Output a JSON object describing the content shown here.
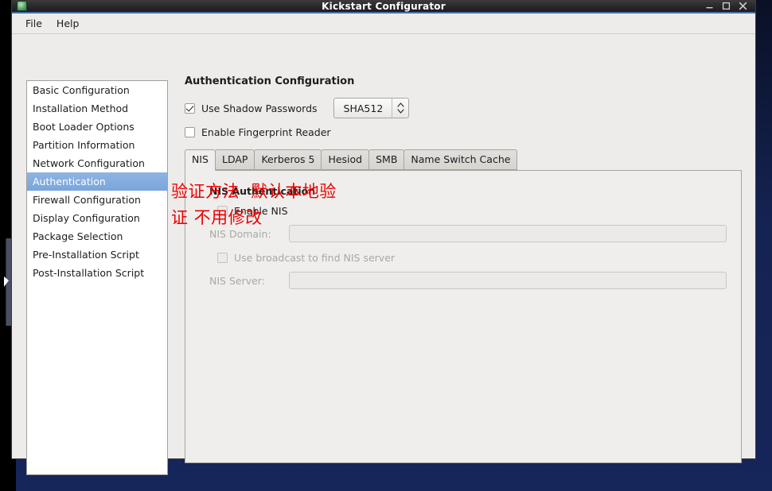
{
  "window": {
    "title": "Kickstart Configurator",
    "icon": "app-icon",
    "buttons": {
      "minimize": "minimize-icon",
      "maximize": "maximize-icon",
      "close": "close-icon"
    }
  },
  "menubar": {
    "items": [
      {
        "label": "File"
      },
      {
        "label": "Help"
      }
    ]
  },
  "sidebar": {
    "items": [
      {
        "label": "Basic Configuration",
        "selected": false
      },
      {
        "label": "Installation Method",
        "selected": false
      },
      {
        "label": "Boot Loader Options",
        "selected": false
      },
      {
        "label": "Partition Information",
        "selected": false
      },
      {
        "label": "Network Configuration",
        "selected": false
      },
      {
        "label": "Authentication",
        "selected": true
      },
      {
        "label": "Firewall Configuration",
        "selected": false
      },
      {
        "label": "Display Configuration",
        "selected": false
      },
      {
        "label": "Package Selection",
        "selected": false
      },
      {
        "label": "Pre-Installation Script",
        "selected": false
      },
      {
        "label": "Post-Installation Script",
        "selected": false
      }
    ]
  },
  "main": {
    "title": "Authentication Configuration",
    "shadow_passwords": {
      "label": "Use Shadow Passwords",
      "checked": true
    },
    "hash_algorithm": {
      "value": "SHA512",
      "stepper": "spin-up-down-icon"
    },
    "fingerprint_reader": {
      "label": "Enable Fingerprint Reader",
      "checked": false
    },
    "tabs": [
      {
        "label": "NIS",
        "active": true
      },
      {
        "label": "LDAP",
        "active": false
      },
      {
        "label": "Kerberos 5",
        "active": false
      },
      {
        "label": "Hesiod",
        "active": false
      },
      {
        "label": "SMB",
        "active": false
      },
      {
        "label": "Name Switch Cache",
        "active": false
      }
    ],
    "nis_panel": {
      "group_title": "NIS Authentication",
      "enable_nis": {
        "label": "Enable NIS",
        "checked": false
      },
      "nis_domain": {
        "label": "NIS Domain:",
        "value": "",
        "placeholder": ""
      },
      "use_broadcast": {
        "label": "Use broadcast to find NIS server",
        "checked": false
      },
      "nis_server": {
        "label": "NIS Server:",
        "value": "",
        "placeholder": ""
      }
    }
  },
  "annotation": {
    "line1": "验证方法  默认本地验",
    "line2": "证 不用修改",
    "color": "#ee0000"
  },
  "colors": {
    "accent_selection": "#7aa5dd",
    "titlebar_underline": "#4a6ea8",
    "window_bg": "#edecea",
    "desktop_bg": "#16255a",
    "annotation_red": "#ee0000"
  }
}
